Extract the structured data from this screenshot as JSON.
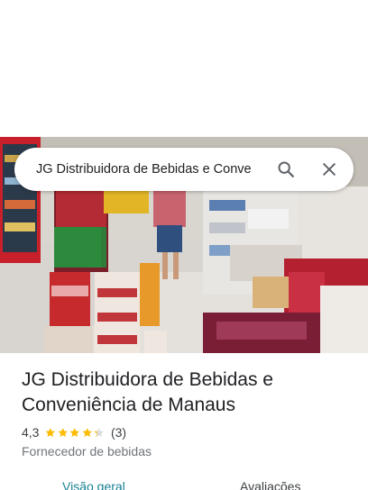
{
  "search": {
    "query": "JG Distribuidora de Bebidas e Conve"
  },
  "place": {
    "name": "JG Distribuidora de Bebidas e Conveniência de Manaus",
    "rating": "4,3",
    "rating_value": 4.3,
    "review_count": "(3)",
    "category": "Fornecedor de bebidas"
  },
  "tabs": [
    {
      "label": "Visão geral",
      "selected": true
    },
    {
      "label": "Avaliações",
      "selected": false
    }
  ],
  "colors": {
    "star": "#fbbc04",
    "star_empty": "#dadce0",
    "selected_tab": "#188193"
  },
  "icons": {
    "search": "search-icon",
    "close": "close-icon",
    "star": "star-icon"
  }
}
